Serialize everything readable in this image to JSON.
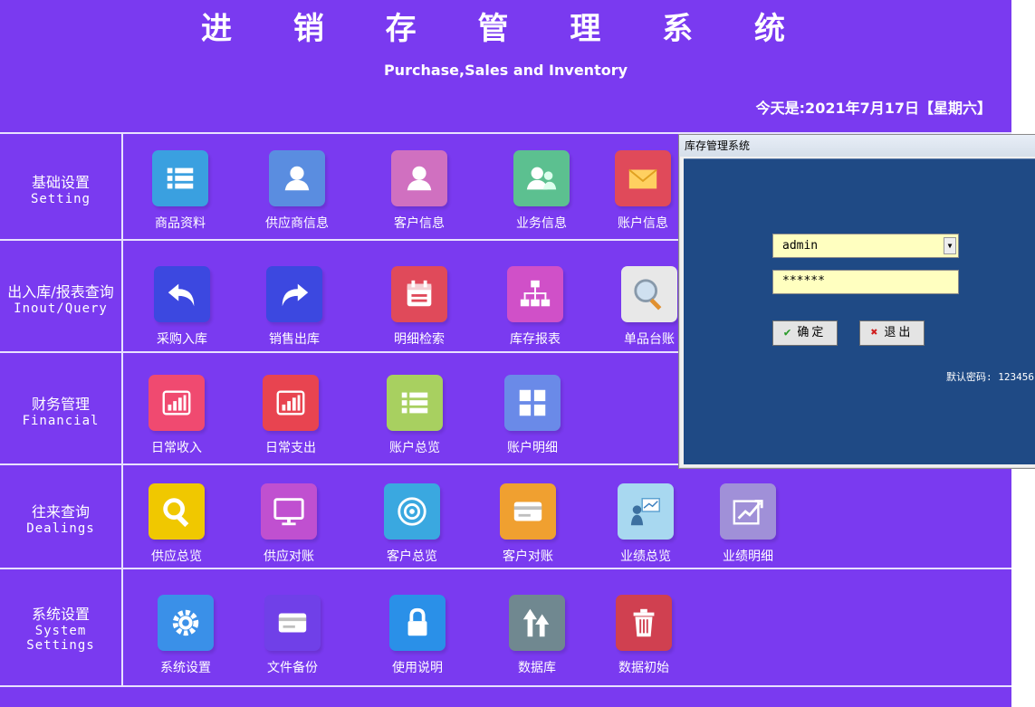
{
  "header": {
    "title": "进 销 存 管 理 系 统",
    "subtitle": "Purchase,Sales and Inventory",
    "date": "今天是:2021年7月17日【星期六】"
  },
  "rows": [
    {
      "cn": "基础设置",
      "en": "Setting",
      "items": [
        {
          "label": "商品资料",
          "icon": "list-icon",
          "color": "#3aa0e0"
        },
        {
          "label": "供应商信息",
          "icon": "user-icon",
          "color": "#5a8de0"
        },
        {
          "label": "客户信息",
          "icon": "user-icon",
          "color": "#d070c0"
        },
        {
          "label": "业务信息",
          "icon": "users-icon",
          "color": "#5cc090"
        },
        {
          "label": "账户信息",
          "icon": "mail-icon",
          "color": "#e04a5a"
        }
      ]
    },
    {
      "cn": "出入库/报表查询",
      "en": "Inout/Query",
      "items": [
        {
          "label": "采购入库",
          "icon": "undo-icon",
          "color": "#3c48e0"
        },
        {
          "label": "销售出库",
          "icon": "redo-icon",
          "color": "#3c48e0"
        },
        {
          "label": "明细检索",
          "icon": "calendar-icon",
          "color": "#e04a5a"
        },
        {
          "label": "库存报表",
          "icon": "hierarchy-icon",
          "color": "#d050c8"
        },
        {
          "label": "单品台账",
          "icon": "magnifier-icon",
          "color": "#e8e8e8"
        }
      ]
    },
    {
      "cn": "财务管理",
      "en": "Financial",
      "items": [
        {
          "label": "日常收入",
          "icon": "bar-chart-icon",
          "color": "#f04a70"
        },
        {
          "label": "日常支出",
          "icon": "bar-chart-icon",
          "color": "#e84450"
        },
        {
          "label": "账户总览",
          "icon": "list-icon",
          "color": "#a8d060"
        },
        {
          "label": "账户明细",
          "icon": "grid-icon",
          "color": "#6a8ae8"
        }
      ]
    },
    {
      "cn": "往来查询",
      "en": "Dealings",
      "items": [
        {
          "label": "供应总览",
          "icon": "search-icon",
          "color": "#f0c800"
        },
        {
          "label": "供应对账",
          "icon": "monitor-icon",
          "color": "#c050d0"
        },
        {
          "label": "客户总览",
          "icon": "target-icon",
          "color": "#3aa8e0"
        },
        {
          "label": "客户对账",
          "icon": "card-icon",
          "color": "#f0a030"
        },
        {
          "label": "业绩总览",
          "icon": "presenter-icon",
          "color": "#a8d8f0"
        },
        {
          "label": "业绩明细",
          "icon": "trend-icon",
          "color": "#a090d8"
        }
      ]
    },
    {
      "cn": "系统设置",
      "en": "System Settings",
      "items": [
        {
          "label": "系统设置",
          "icon": "gear-icon",
          "color": "#3a90e8"
        },
        {
          "label": "文件备份",
          "icon": "card-icon",
          "color": "#7040e8"
        },
        {
          "label": "使用说明",
          "icon": "lock-icon",
          "color": "#2a90e8"
        },
        {
          "label": "数据库",
          "icon": "arrows-up-icon",
          "color": "#708890"
        },
        {
          "label": "数据初始",
          "icon": "trash-icon",
          "color": "#d04050"
        }
      ]
    }
  ],
  "dialog": {
    "title": "库存管理系统",
    "username": "admin",
    "password": "******",
    "ok_label": "确定",
    "exit_label": "退出",
    "hint": "默认密码: 123456"
  }
}
